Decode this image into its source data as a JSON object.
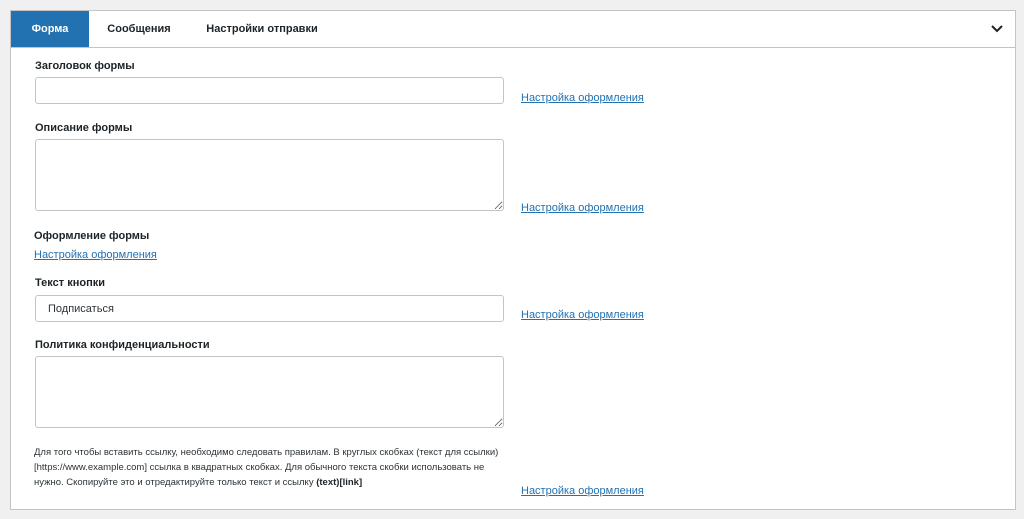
{
  "tabs": {
    "form": "Форма",
    "messages": "Сообщения",
    "send_settings": "Настройки отправки"
  },
  "form": {
    "title_label": "Заголовок формы",
    "title_value": "",
    "description_label": "Описание формы",
    "description_value": "",
    "design_label": "Оформление формы",
    "button_text_label": "Текст кнопки",
    "button_text_value": "Подписаться",
    "privacy_label": "Политика конфиденциальности",
    "privacy_value": "",
    "style_link": "Настройка оформления",
    "help_text": "Для того чтобы вставить ссылку, необходимо следовать правилам. В круглых скобках (текст для ссылки) [https://www.example.com] ссылка в квадратных скобках. Для обычного текста скобки использовать не нужно. Скопируйте это и отредактируйте только текст и ссылку",
    "help_code": "(text)[link]"
  },
  "colors": {
    "accent": "#2271b1",
    "border": "#c3c4c7",
    "background": "#f0f0f1"
  },
  "icons": {
    "collapse": "chevron-down-icon"
  }
}
